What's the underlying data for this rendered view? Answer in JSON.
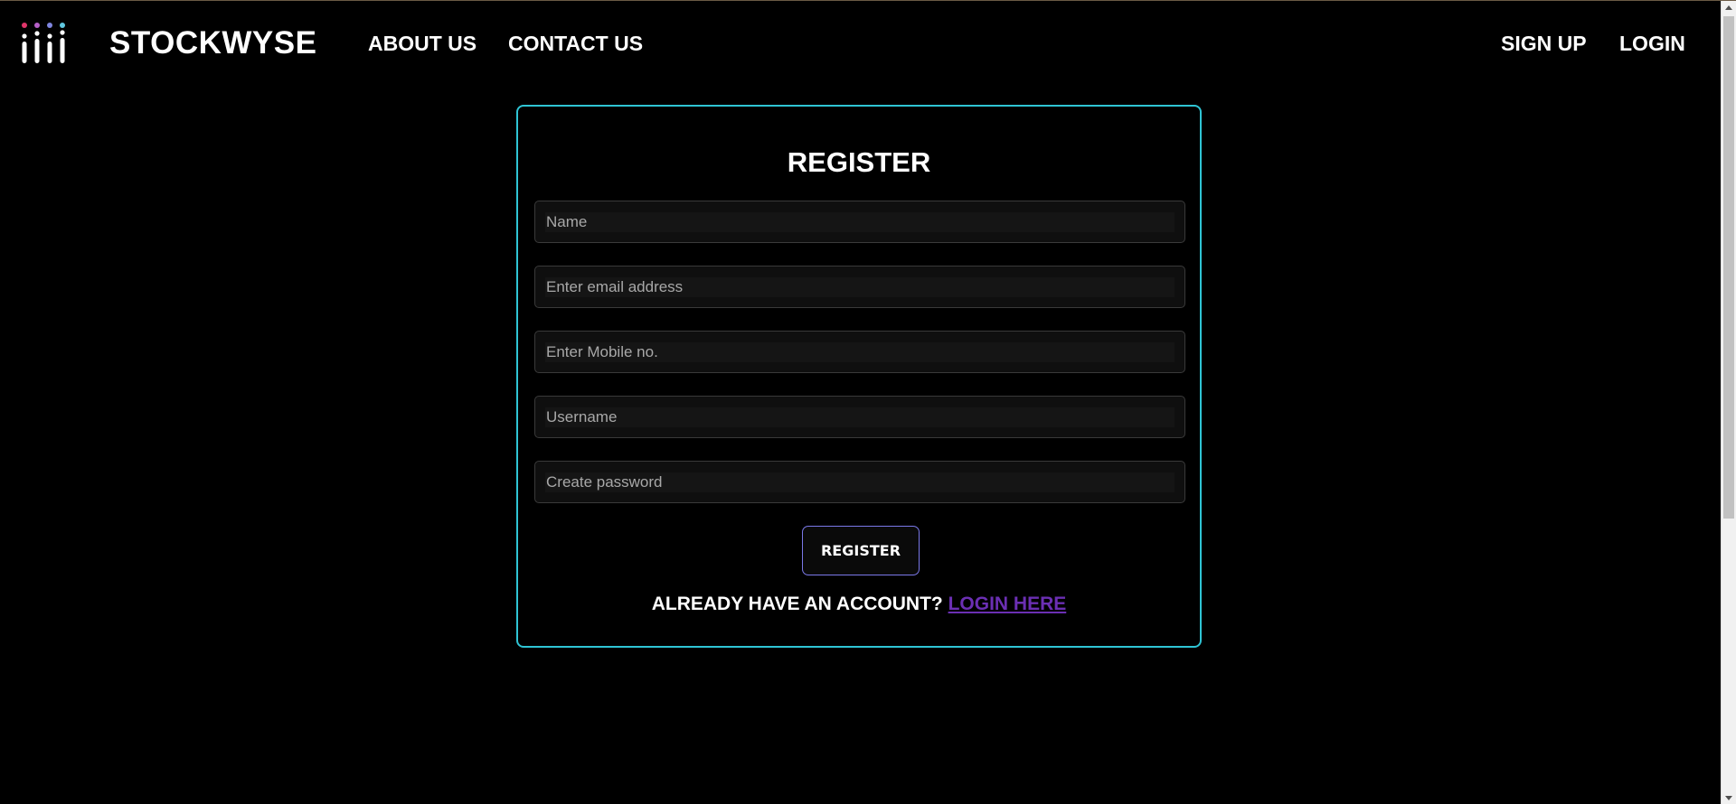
{
  "navbar": {
    "brand": "STOCKWYSE",
    "links": {
      "about": "ABOUT US",
      "contact": "CONTACT US",
      "signup": "SIGN UP",
      "login": "LOGIN"
    },
    "logo_icon": "bars-dots-logo-icon"
  },
  "register": {
    "title": "REGISTER",
    "fields": {
      "name": {
        "placeholder": "Name",
        "value": ""
      },
      "email": {
        "placeholder": "Enter email address",
        "value": ""
      },
      "mobile": {
        "placeholder": "Enter Mobile no.",
        "value": ""
      },
      "username": {
        "placeholder": "Username",
        "value": ""
      },
      "password": {
        "placeholder": "Create password",
        "value": ""
      }
    },
    "button_label": "REGISTER",
    "already_text": "ALREADY HAVE AN ACCOUNT?",
    "login_link": "LOGIN HERE"
  },
  "colors": {
    "background": "#000000",
    "card_border": "#2fc4d4",
    "button_border": "#7a78e8",
    "link": "#6b2fb3",
    "logo_dots": [
      "#e0356a",
      "#b55fc7",
      "#7f86e0",
      "#5fc8e0"
    ]
  }
}
